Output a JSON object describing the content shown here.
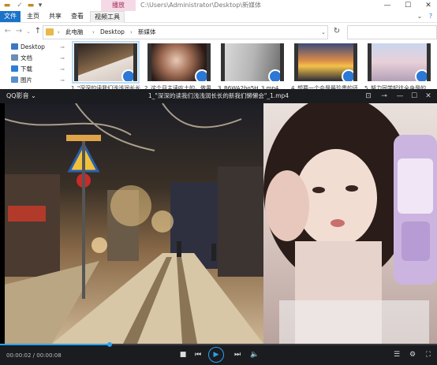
{
  "explorer": {
    "path_title": "C:\\Users\\Administrator\\Desktop\\新媒体",
    "ribbon": {
      "tabs": [
        "文件",
        "主页",
        "共享",
        "查看",
        "视频工具"
      ],
      "context_tab": "播放"
    },
    "breadcrumbs": [
      "此电脑",
      "Desktop",
      "新媒体"
    ],
    "nav_items": [
      {
        "label": "Desktop",
        "icon": "desktop-folder-icon",
        "color": "#3b78c4"
      },
      {
        "label": "文档",
        "icon": "documents-icon",
        "color": "#6b8fb5"
      },
      {
        "label": "下载",
        "icon": "downloads-icon",
        "color": "#2b7fd4"
      },
      {
        "label": "图片",
        "icon": "pictures-icon",
        "color": "#5a8ecb"
      }
    ],
    "files": [
      {
        "caption": "1_\"深深的读我们浅浅润长长",
        "icon": "video-file-thumbnail"
      },
      {
        "caption": "2_这个月主读吃土的，做男",
        "icon": "video-file-thumbnail"
      },
      {
        "caption": "3_B6WA2bo5H_3.mp4",
        "icon": "video-file-thumbnail"
      },
      {
        "caption": "4_想要一个会是最珍贵的还",
        "icon": "video-file-thumbnail"
      },
      {
        "caption": "5_努力同学起往全身是的",
        "icon": "video-file-thumbnail"
      }
    ]
  },
  "player": {
    "app_name": "QQ影音",
    "window_title": "1_\"深深的读我们浅浅润长长的新我们懒懒会\"_1.mp4",
    "time_text": "00:00:02 / 00:00:08",
    "progress": 0.25,
    "accent_color": "#2aa3f2"
  }
}
